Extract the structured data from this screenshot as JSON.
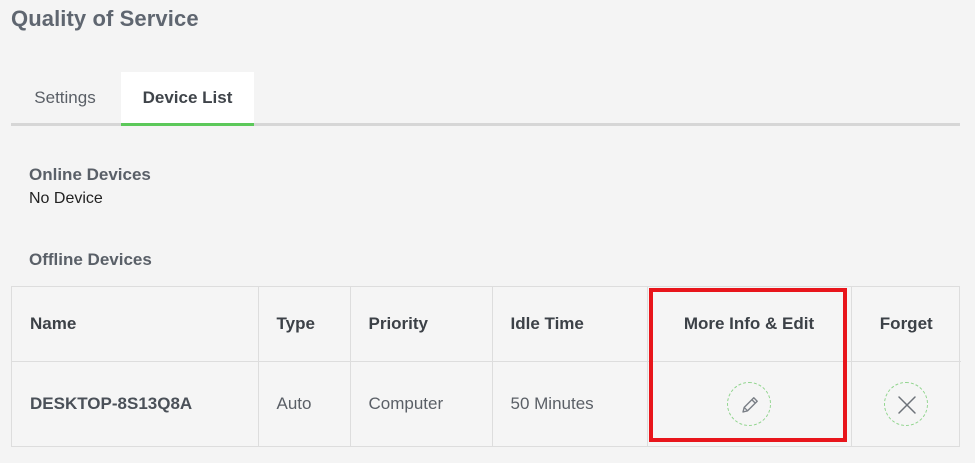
{
  "page": {
    "title": "Quality of Service"
  },
  "tabs": [
    {
      "label": "Settings",
      "active": false
    },
    {
      "label": "Device List",
      "active": true
    }
  ],
  "online": {
    "heading": "Online Devices",
    "empty_text": "No Device"
  },
  "offline": {
    "heading": "Offline Devices",
    "columns": [
      "Name",
      "Type",
      "Priority",
      "Idle Time",
      "More Info & Edit",
      "Forget"
    ],
    "rows": [
      {
        "name": "DESKTOP-8S13Q8A",
        "type": "Auto",
        "priority": "Computer",
        "idle_time": "50 Minutes",
        "edit_icon": "pencil-icon",
        "forget_icon": "close-icon"
      }
    ]
  },
  "colors": {
    "accent": "#5cc85a",
    "highlight": "#e8151b"
  }
}
